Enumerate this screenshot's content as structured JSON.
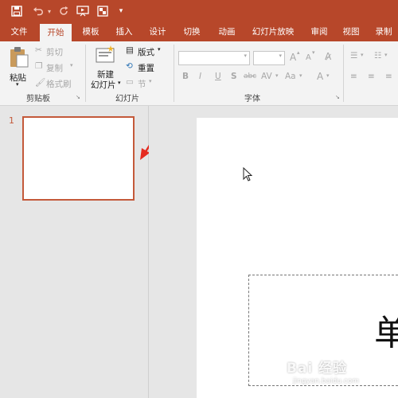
{
  "ribbon_tabs": [
    "文件",
    "开始",
    "模板",
    "插入",
    "设计",
    "切换",
    "动画",
    "幻灯片放映",
    "审阅",
    "视图",
    "录制"
  ],
  "clipboard": {
    "paste": "粘贴",
    "cut": "剪切",
    "copy": "复制",
    "format_painter": "格式刷",
    "group_label": "剪贴板"
  },
  "slides_group": {
    "new_slide_line1": "新建",
    "new_slide_line2": "幻灯片",
    "layout": "版式",
    "reset": "重置",
    "section": "节",
    "group_label": "幻灯片"
  },
  "font_group": {
    "group_label": "字体",
    "grow": "A",
    "shrink": "A",
    "bold": "B",
    "italic": "I",
    "underline": "U",
    "shadow": "S",
    "strike": "abc",
    "spacing": "AV",
    "case": "Aa",
    "color": "A"
  },
  "thumbnails": {
    "slide_number": "1"
  },
  "slide": {
    "big_char": "单"
  },
  "watermark": {
    "text": "Bai 经验",
    "sub": "jingyan.baidu.com"
  },
  "colors": {
    "accent": "#b7472a",
    "arrow": "#e52b20"
  }
}
